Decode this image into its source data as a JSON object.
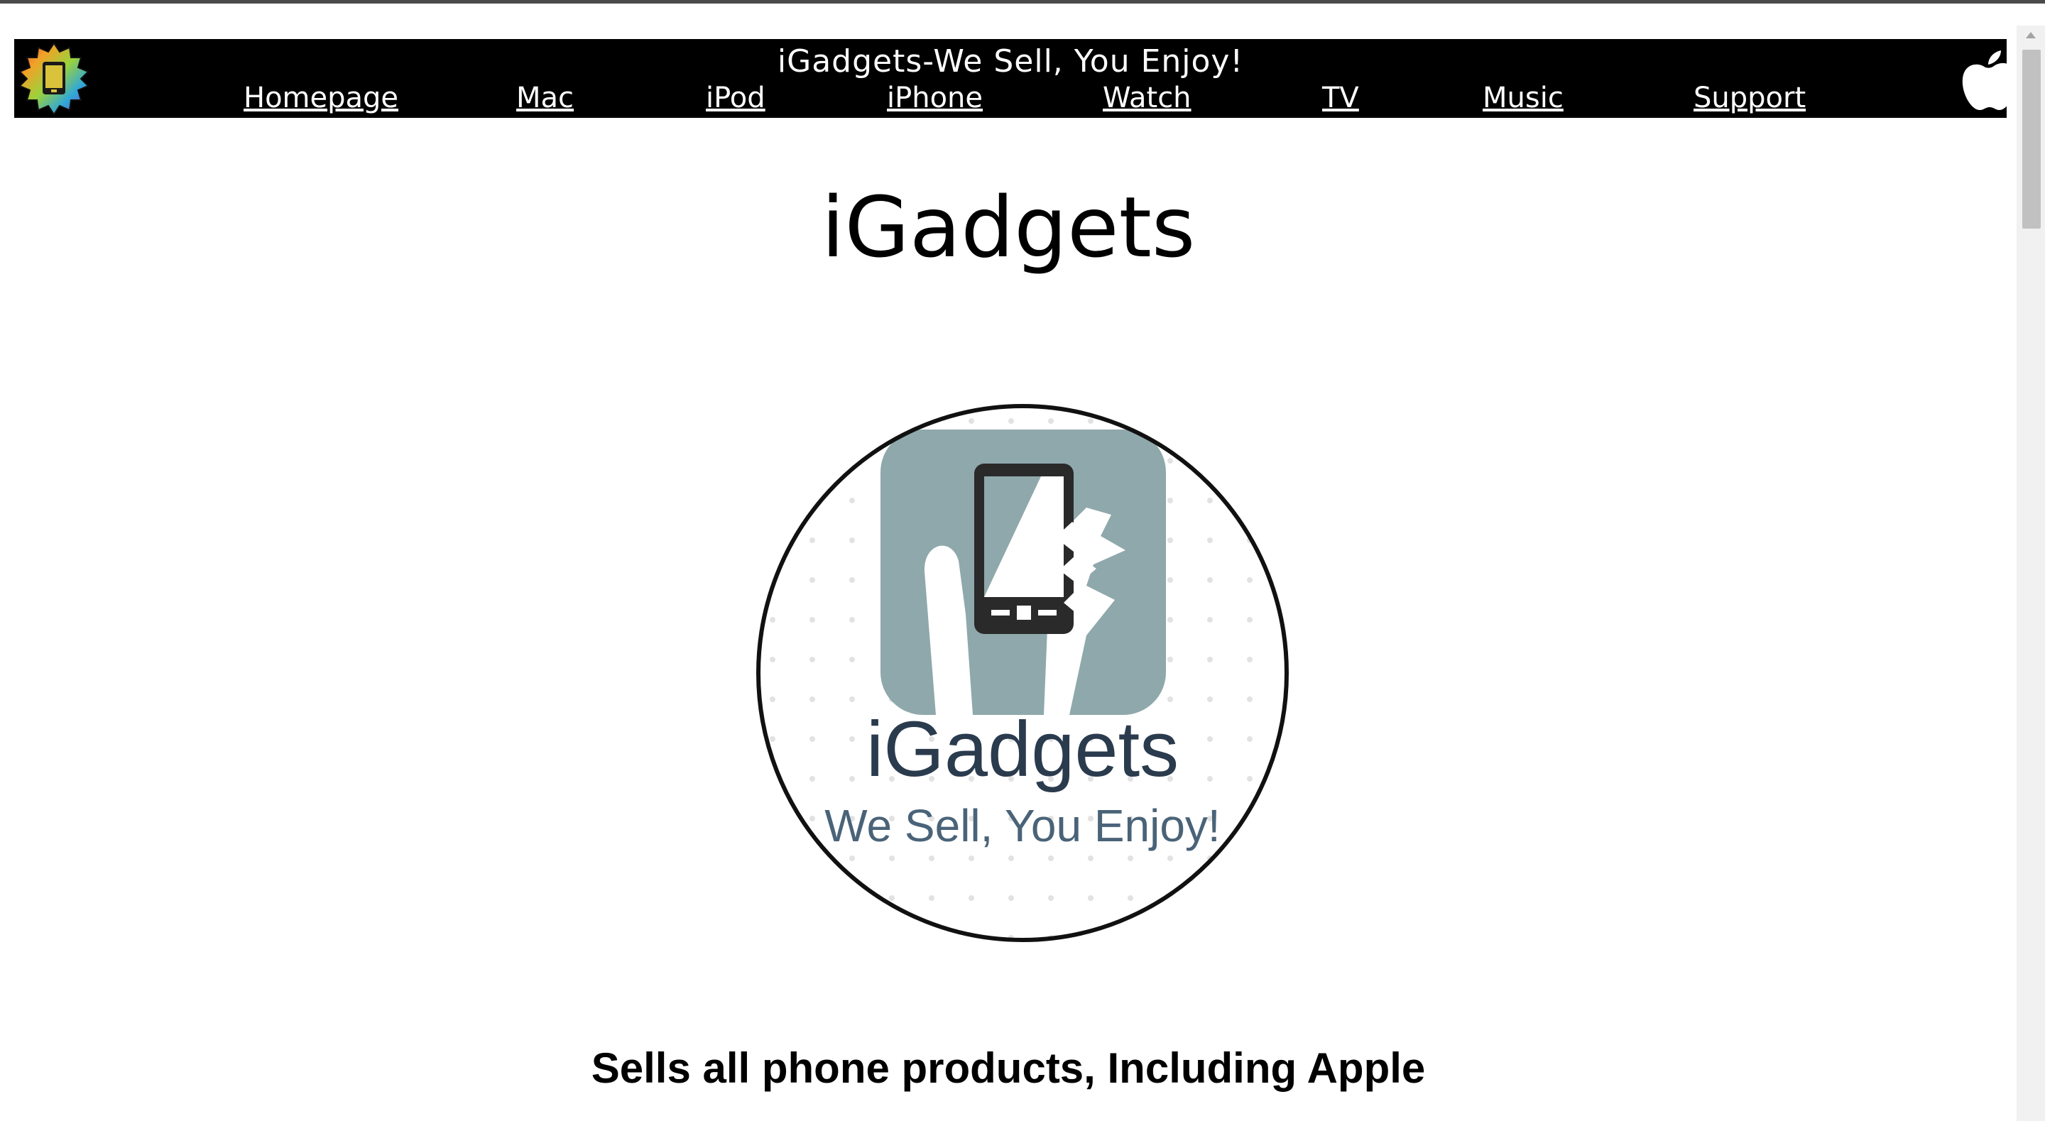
{
  "header": {
    "title": "iGadgets-We Sell, You Enjoy!",
    "nav": [
      {
        "label": "Homepage"
      },
      {
        "label": "Mac"
      },
      {
        "label": "iPod"
      },
      {
        "label": "iPhone"
      },
      {
        "label": "Watch"
      },
      {
        "label": "TV"
      },
      {
        "label": "Music"
      },
      {
        "label": "Support"
      }
    ],
    "logo_icon": "igadgets-badge-icon",
    "apple_icon": "apple-icon"
  },
  "main": {
    "title": "iGadgets",
    "logo": {
      "brand": "iGadgets",
      "slogan": "We Sell, You Enjoy!"
    },
    "tagline": "Sells all phone products, Including Apple"
  },
  "colors": {
    "navbar": "#000000",
    "nav_text": "#ffffff",
    "logo_tile": "#8fa8ab",
    "logo_text": "#2b3b4e",
    "logo_slogan": "#4a6378"
  }
}
